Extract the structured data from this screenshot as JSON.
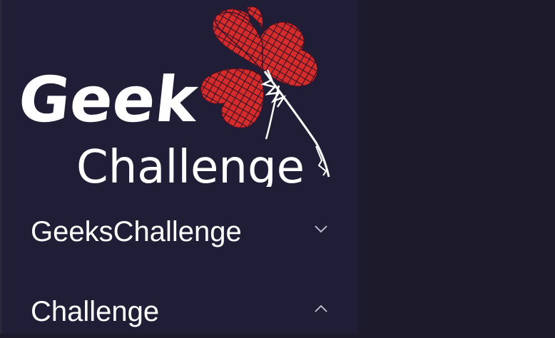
{
  "logo": {
    "text_line1": "Geek",
    "text_line2": "Challenge",
    "icon": "four-leaf-clover-icon"
  },
  "menu": [
    {
      "label": "GeeksChallenge",
      "state": "collapsed",
      "icon": "chevron-down-icon"
    },
    {
      "label": "Challenge",
      "state": "expanded",
      "icon": "chevron-up-icon"
    }
  ],
  "colors": {
    "sidebar_bg": "#201e36",
    "main_bg": "#1c1a2b",
    "text": "#ffffff",
    "clover_red": "#d42b2b"
  }
}
